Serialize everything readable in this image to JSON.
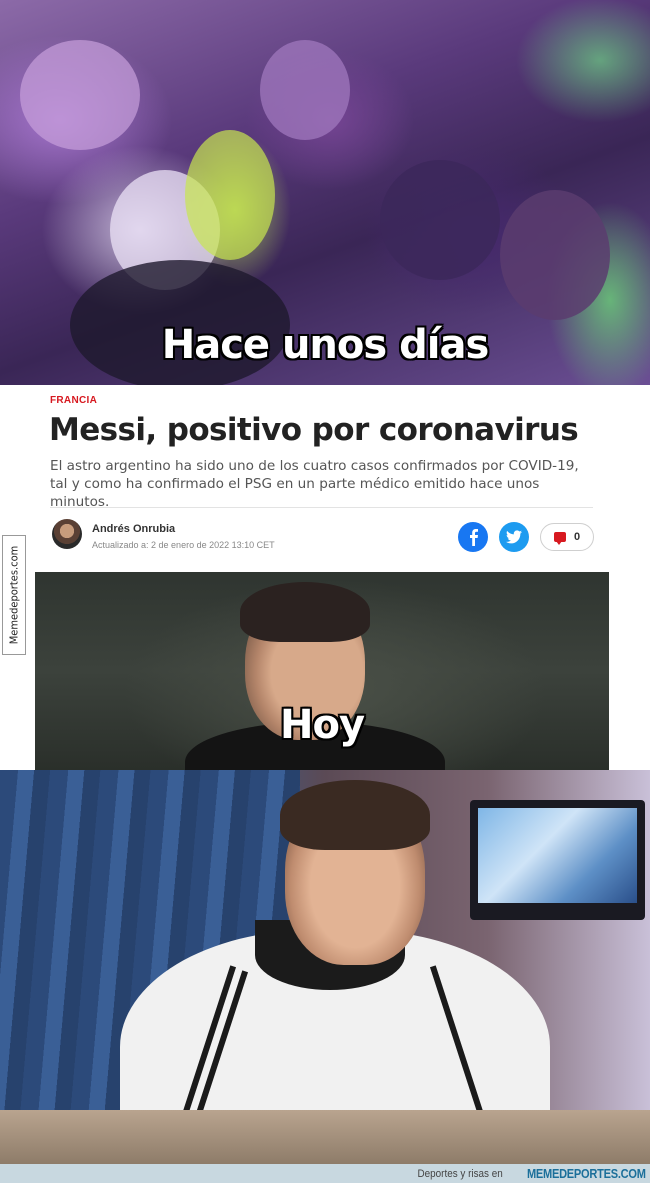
{
  "top_panel": {
    "caption": "Hace unos días"
  },
  "article": {
    "section": "FRANCIA",
    "headline": "Messi, positivo por coronavirus",
    "lede": "El astro argentino ha sido uno de los cuatro casos confirmados por COVID-19, tal y como ha confirmado el PSG en un parte médico emitido hace unos minutos.",
    "author": "Andrés Onrubia",
    "updated": "Actualizado a: 2 de enero de 2022 13:10 CET",
    "share": {
      "facebook_icon": "facebook-icon",
      "twitter_icon": "twitter-icon"
    },
    "comments_count": "0",
    "photo_caption": "Hoy"
  },
  "side_watermark": "Memedeportes.com",
  "footer": {
    "text": "Deportes y risas en",
    "brand": "MEMEDEPORTES.COM"
  },
  "colors": {
    "section_red": "#d71920",
    "facebook_blue": "#1877f2",
    "twitter_blue": "#1d9bf0",
    "brand_blue": "#1b6f9a"
  }
}
